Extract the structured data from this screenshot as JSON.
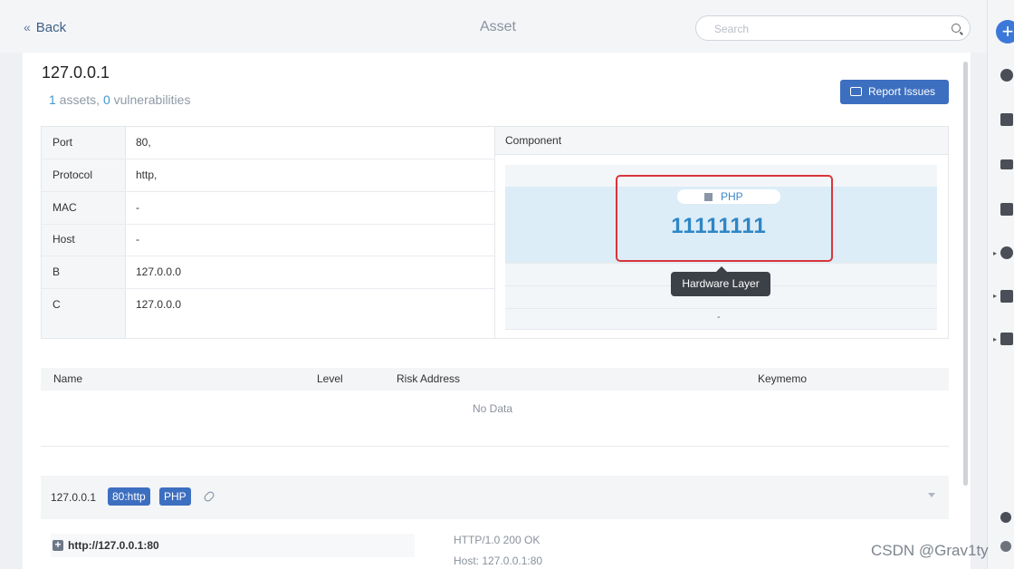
{
  "header": {
    "back_label": "Back",
    "title": "Asset",
    "search_placeholder": "Search"
  },
  "asset": {
    "ip": "127.0.0.1",
    "assets_count": "1",
    "assets_text": " assets, ",
    "vuln_count": "0",
    "vuln_text": " vulnerabilities",
    "report_button": "Report Issues"
  },
  "info_table": [
    {
      "key": "Port",
      "value": "80,"
    },
    {
      "key": "Protocol",
      "value": "http,"
    },
    {
      "key": "MAC",
      "value": "-"
    },
    {
      "key": "Host",
      "value": "-"
    },
    {
      "key": "B",
      "value": "127.0.0.0"
    },
    {
      "key": "C",
      "value": "127.0.0.0"
    }
  ],
  "component": {
    "header": "Component",
    "tag": "PHP",
    "highlight_value": "11111111",
    "tooltip": "Hardware Layer",
    "empty_value": "-"
  },
  "vuln_table": {
    "columns": [
      "Name",
      "Level",
      "Risk Address",
      "Keymemo"
    ],
    "empty_text": "No Data"
  },
  "service": {
    "ip": "127.0.0.1",
    "port_tag": "80:http",
    "tech_tag": "PHP",
    "url": "http://127.0.0.1:80",
    "response_lines": [
      "HTTP/1.0 200 OK",
      "Host: 127.0.0.1:80"
    ]
  },
  "watermark": "CSDN @Grav1ty",
  "icons": [
    "double-chevron-left-icon",
    "search-icon",
    "plus-icon",
    "chat-icon",
    "image-icon",
    "link-icon",
    "chevron-down-icon",
    "plus-box-icon"
  ],
  "colors": {
    "accent": "#3d6fc0",
    "highlight_blue": "#2f86c5",
    "red_annotation": "#d9353b"
  }
}
